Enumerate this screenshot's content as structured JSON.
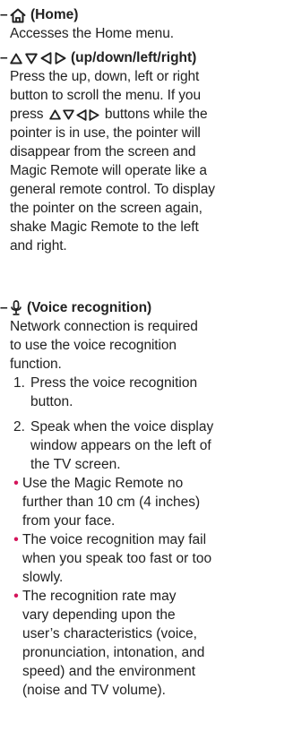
{
  "home": {
    "title": "(Home)",
    "icon": "home-icon",
    "desc": "Accesses the Home menu."
  },
  "nav": {
    "title": "(up/down/left/right)",
    "icons": [
      "up-arrow-icon",
      "down-arrow-icon",
      "left-arrow-icon",
      "right-arrow-icon"
    ],
    "lines": [
      "Press the up, down, left or right",
      "button to scroll the menu. If you",
      "press",
      "buttons while the",
      "pointer is in use, the pointer will",
      "disappear from the screen and",
      "Magic Remote will operate like a",
      "general remote control. To display",
      "the pointer on the screen again,",
      "shake Magic Remote to the left",
      "and right."
    ]
  },
  "voice": {
    "title": "(Voice recognition)",
    "icon": "microphone-icon",
    "intro_lines": [
      "Network connection is required",
      "to use the voice recognition",
      "function."
    ],
    "steps": [
      {
        "num": "1.",
        "lines": [
          "Press the voice recognition",
          "button."
        ]
      },
      {
        "num": "2.",
        "lines": [
          "Speak when the voice display",
          "window appears on the left of",
          "the TV screen."
        ]
      }
    ],
    "bullets": [
      {
        "lines": [
          "Use the Magic Remote no",
          "further than 10 cm (4 inches)",
          "from your face."
        ]
      },
      {
        "lines": [
          "The voice recognition may fail",
          "when you speak too fast or too",
          "slowly."
        ]
      },
      {
        "lines": [
          "The recognition rate may",
          "vary depending upon the",
          "user’s characteristics (voice,",
          "pronunciation, intonation, and",
          "speed) and the environment",
          "(noise and TV volume)."
        ]
      }
    ],
    "bullet_color": "#d4145a"
  }
}
